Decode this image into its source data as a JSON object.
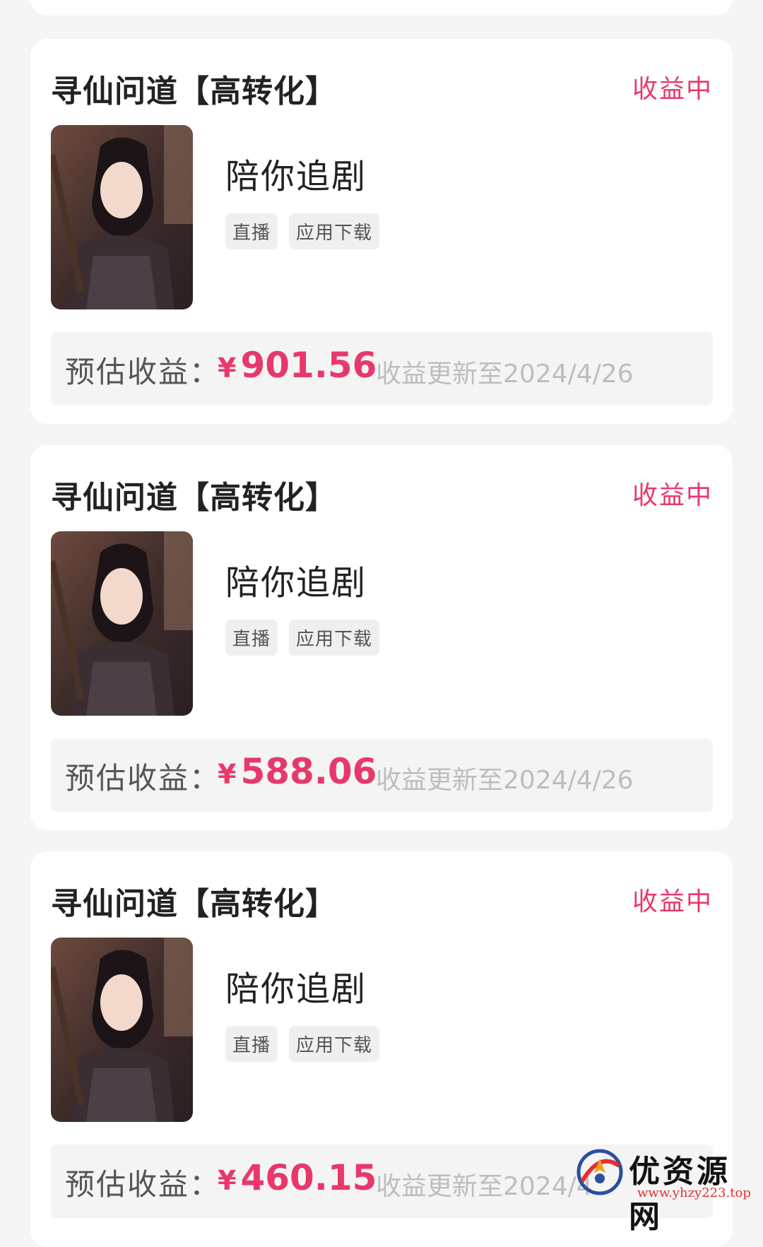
{
  "cards": [
    {
      "title": "寻仙问道【高转化】",
      "status": "收益中",
      "app_name": "陪你追剧",
      "tags": [
        "直播",
        "应用下载"
      ],
      "earn_label": "预估收益：",
      "currency": "¥",
      "amount": "901.56",
      "update_text": "收益更新至2024/4/26"
    },
    {
      "title": "寻仙问道【高转化】",
      "status": "收益中",
      "app_name": "陪你追剧",
      "tags": [
        "直播",
        "应用下载"
      ],
      "earn_label": "预估收益：",
      "currency": "¥",
      "amount": "588.06",
      "update_text": "收益更新至2024/4/26"
    },
    {
      "title": "寻仙问道【高转化】",
      "status": "收益中",
      "app_name": "陪你追剧",
      "tags": [
        "直播",
        "应用下载"
      ],
      "earn_label": "预估收益：",
      "currency": "¥",
      "amount": "460.15",
      "update_text": "收益更新至2024/4"
    }
  ],
  "watermark": {
    "text": "优资源网",
    "url": "www.yhzy223.top"
  },
  "colors": {
    "accent": "#e8386b",
    "background": "#f5f5f5",
    "card": "#ffffff"
  }
}
